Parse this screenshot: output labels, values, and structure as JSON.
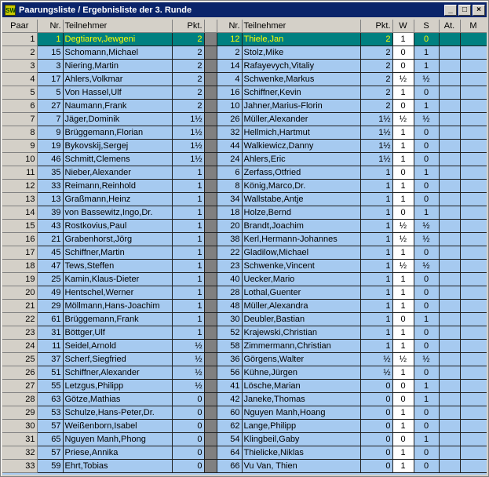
{
  "window": {
    "title": "Paarungsliste / Ergebnisliste der 3. Runde",
    "icon_label": "SW",
    "buttons": [
      "_",
      "□",
      "×"
    ]
  },
  "columns": [
    "Paar",
    "Nr.",
    "Teilnehmer",
    "Pkt.",
    "",
    "Nr.",
    "Teilnehmer",
    "Pkt.",
    "W",
    "S",
    "At.",
    "M"
  ],
  "rows": [
    {
      "paar": "1",
      "nr1": "1",
      "name1": "Degtiarev,Jewgeni",
      "pkt1": "2",
      "nr2": "12",
      "name2": "Thiele,Jan",
      "pkt2": "2",
      "w": "1",
      "s": "0"
    },
    {
      "paar": "2",
      "nr1": "15",
      "name1": "Schomann,Michael",
      "pkt1": "2",
      "nr2": "2",
      "name2": "Stolz,Mike",
      "pkt2": "2",
      "w": "0",
      "s": "1"
    },
    {
      "paar": "3",
      "nr1": "3",
      "name1": "Niering,Martin",
      "pkt1": "2",
      "nr2": "14",
      "name2": "Rafayevych,Vitaliy",
      "pkt2": "2",
      "w": "0",
      "s": "1"
    },
    {
      "paar": "4",
      "nr1": "17",
      "name1": "Ahlers,Volkmar",
      "pkt1": "2",
      "nr2": "4",
      "name2": "Schwenke,Markus",
      "pkt2": "2",
      "w": "½",
      "s": "½"
    },
    {
      "paar": "5",
      "nr1": "5",
      "name1": "Von Hassel,Ulf",
      "pkt1": "2",
      "nr2": "16",
      "name2": "Schiffner,Kevin",
      "pkt2": "2",
      "w": "1",
      "s": "0"
    },
    {
      "paar": "6",
      "nr1": "27",
      "name1": "Naumann,Frank",
      "pkt1": "2",
      "nr2": "10",
      "name2": "Jahner,Marius-Florin",
      "pkt2": "2",
      "w": "0",
      "s": "1"
    },
    {
      "paar": "7",
      "nr1": "7",
      "name1": "Jäger,Dominik",
      "pkt1": "1½",
      "nr2": "26",
      "name2": "Müller,Alexander",
      "pkt2": "1½",
      "w": "½",
      "s": "½"
    },
    {
      "paar": "8",
      "nr1": "9",
      "name1": "Brüggemann,Florian",
      "pkt1": "1½",
      "nr2": "32",
      "name2": "Hellmich,Hartmut",
      "pkt2": "1½",
      "w": "1",
      "s": "0"
    },
    {
      "paar": "9",
      "nr1": "19",
      "name1": "Bykovskij,Sergej",
      "pkt1": "1½",
      "nr2": "44",
      "name2": "Walkiewicz,Danny",
      "pkt2": "1½",
      "w": "1",
      "s": "0"
    },
    {
      "paar": "10",
      "nr1": "46",
      "name1": "Schmitt,Clemens",
      "pkt1": "1½",
      "nr2": "24",
      "name2": "Ahlers,Eric",
      "pkt2": "1½",
      "w": "1",
      "s": "0"
    },
    {
      "paar": "11",
      "nr1": "35",
      "name1": "Nieber,Alexander",
      "pkt1": "1",
      "nr2": "6",
      "name2": "Zerfass,Otfried",
      "pkt2": "1",
      "w": "0",
      "s": "1"
    },
    {
      "paar": "12",
      "nr1": "33",
      "name1": "Reimann,Reinhold",
      "pkt1": "1",
      "nr2": "8",
      "name2": "König,Marco,Dr.",
      "pkt2": "1",
      "w": "1",
      "s": "0"
    },
    {
      "paar": "13",
      "nr1": "13",
      "name1": "Graßmann,Heinz",
      "pkt1": "1",
      "nr2": "34",
      "name2": "Wallstabe,Antje",
      "pkt2": "1",
      "w": "1",
      "s": "0"
    },
    {
      "paar": "14",
      "nr1": "39",
      "name1": "von Bassewitz,Ingo,Dr.",
      "pkt1": "1",
      "nr2": "18",
      "name2": "Holze,Bernd",
      "pkt2": "1",
      "w": "0",
      "s": "1"
    },
    {
      "paar": "15",
      "nr1": "43",
      "name1": "Rostkovius,Paul",
      "pkt1": "1",
      "nr2": "20",
      "name2": "Brandt,Joachim",
      "pkt2": "1",
      "w": "½",
      "s": "½"
    },
    {
      "paar": "16",
      "nr1": "21",
      "name1": "Grabenhorst,Jörg",
      "pkt1": "1",
      "nr2": "38",
      "name2": "Kerl,Hermann-Johannes",
      "pkt2": "1",
      "w": "½",
      "s": "½"
    },
    {
      "paar": "17",
      "nr1": "45",
      "name1": "Schiffner,Martin",
      "pkt1": "1",
      "nr2": "22",
      "name2": "Gladilow,Michael",
      "pkt2": "1",
      "w": "1",
      "s": "0"
    },
    {
      "paar": "18",
      "nr1": "47",
      "name1": "Tews,Steffen",
      "pkt1": "1",
      "nr2": "23",
      "name2": "Schwenke,Vincent",
      "pkt2": "1",
      "w": "½",
      "s": "½"
    },
    {
      "paar": "19",
      "nr1": "25",
      "name1": "Kamin,Klaus-Dieter",
      "pkt1": "1",
      "nr2": "40",
      "name2": "Uecker,Mario",
      "pkt2": "1",
      "w": "1",
      "s": "0"
    },
    {
      "paar": "20",
      "nr1": "49",
      "name1": "Hentschel,Werner",
      "pkt1": "1",
      "nr2": "28",
      "name2": "Lothal,Guenter",
      "pkt2": "1",
      "w": "1",
      "s": "0"
    },
    {
      "paar": "21",
      "nr1": "29",
      "name1": "Möllmann,Hans-Joachim",
      "pkt1": "1",
      "nr2": "48",
      "name2": "Müller,Alexandra",
      "pkt2": "1",
      "w": "1",
      "s": "0"
    },
    {
      "paar": "22",
      "nr1": "61",
      "name1": "Brüggemann,Frank",
      "pkt1": "1",
      "nr2": "30",
      "name2": "Deubler,Bastian",
      "pkt2": "1",
      "w": "0",
      "s": "1"
    },
    {
      "paar": "23",
      "nr1": "31",
      "name1": "Böttger,Ulf",
      "pkt1": "1",
      "nr2": "52",
      "name2": "Krajewski,Christian",
      "pkt2": "1",
      "w": "1",
      "s": "0"
    },
    {
      "paar": "24",
      "nr1": "11",
      "name1": "Seidel,Arnold",
      "pkt1": "½",
      "nr2": "58",
      "name2": "Zimmermann,Christian",
      "pkt2": "1",
      "w": "1",
      "s": "0"
    },
    {
      "paar": "25",
      "nr1": "37",
      "name1": "Scherf,Siegfried",
      "pkt1": "½",
      "nr2": "36",
      "name2": "Görgens,Walter",
      "pkt2": "½",
      "w": "½",
      "s": "½"
    },
    {
      "paar": "26",
      "nr1": "51",
      "name1": "Schiffner,Alexander",
      "pkt1": "½",
      "nr2": "56",
      "name2": "Kühne,Jürgen",
      "pkt2": "½",
      "w": "1",
      "s": "0"
    },
    {
      "paar": "27",
      "nr1": "55",
      "name1": "Letzgus,Philipp",
      "pkt1": "½",
      "nr2": "41",
      "name2": "Lösche,Marian",
      "pkt2": "0",
      "w": "0",
      "s": "1"
    },
    {
      "paar": "28",
      "nr1": "63",
      "name1": "Götze,Mathias",
      "pkt1": "0",
      "nr2": "42",
      "name2": "Janeke,Thomas",
      "pkt2": "0",
      "w": "0",
      "s": "1"
    },
    {
      "paar": "29",
      "nr1": "53",
      "name1": "Schulze,Hans-Peter,Dr.",
      "pkt1": "0",
      "nr2": "60",
      "name2": "Nguyen Manh,Hoang",
      "pkt2": "0",
      "w": "1",
      "s": "0"
    },
    {
      "paar": "30",
      "nr1": "57",
      "name1": "Weißenborn,Isabel",
      "pkt1": "0",
      "nr2": "62",
      "name2": "Lange,Philipp",
      "pkt2": "0",
      "w": "1",
      "s": "0"
    },
    {
      "paar": "31",
      "nr1": "65",
      "name1": "Nguyen Manh,Phong",
      "pkt1": "0",
      "nr2": "54",
      "name2": "Klingbeil,Gaby",
      "pkt2": "0",
      "w": "0",
      "s": "1"
    },
    {
      "paar": "32",
      "nr1": "57",
      "name1": "Priese,Annika",
      "pkt1": "0",
      "nr2": "64",
      "name2": "Thielicke,Niklas",
      "pkt2": "0",
      "w": "1",
      "s": "0"
    },
    {
      "paar": "33",
      "nr1": "59",
      "name1": "Ehrt,Tobias",
      "pkt1": "0",
      "nr2": "66",
      "name2": "Vu Van, Thien",
      "pkt2": "0",
      "w": "1",
      "s": "0"
    }
  ],
  "colors": {
    "selected_row_bg": "#008080",
    "selected_row_text": "#ffff00",
    "cell_bg": "#a6caf0",
    "title_bg": "#0a246a"
  }
}
